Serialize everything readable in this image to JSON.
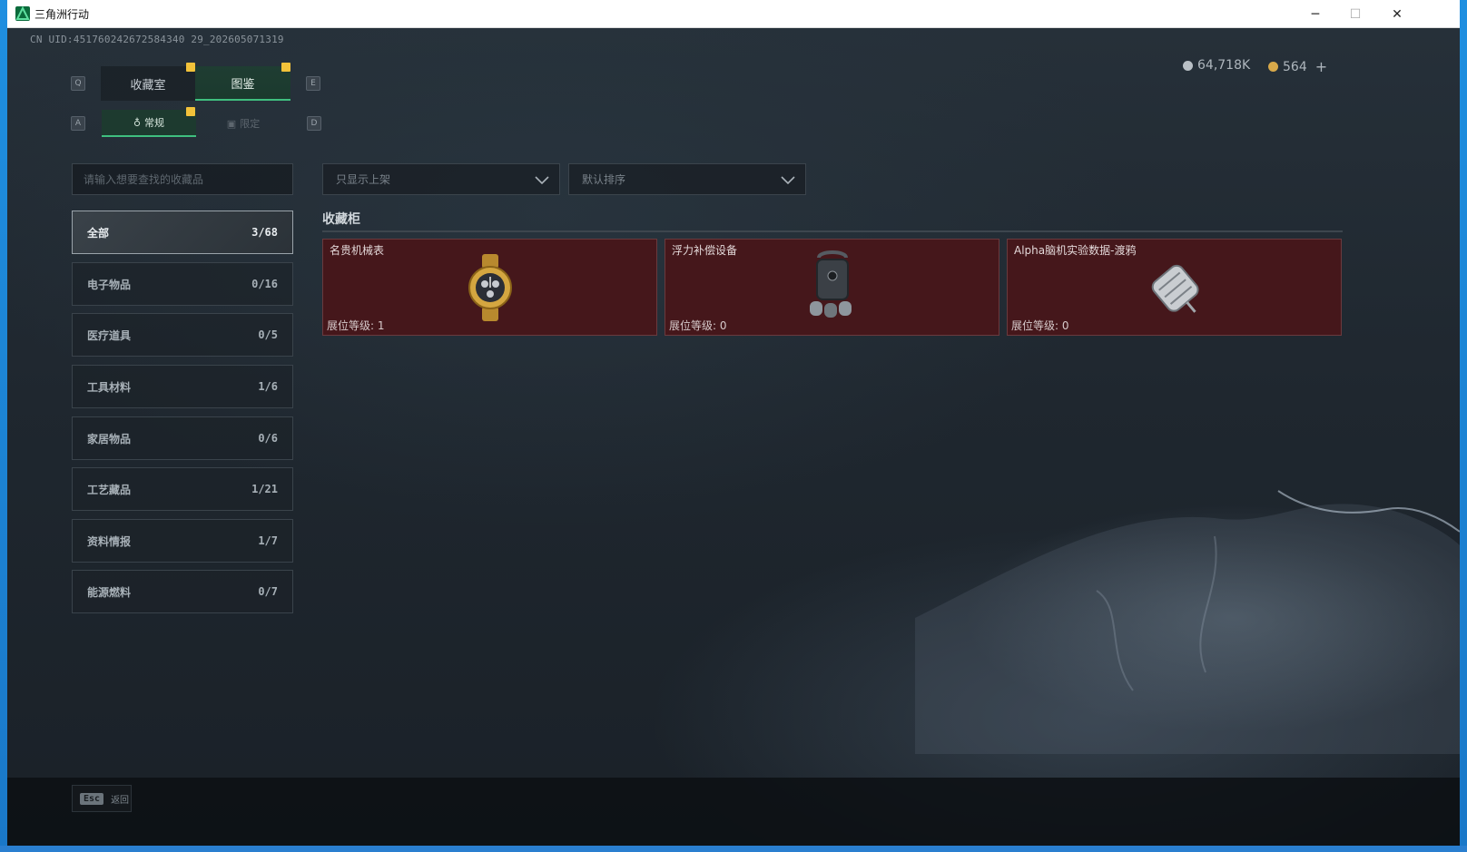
{
  "window": {
    "title": "三角洲行动",
    "minimize": "─",
    "maximize": "☐",
    "close": "✕"
  },
  "uid": "CN UID:451760242672584340 29_202605071319",
  "tabs": {
    "key_left": "Q",
    "key_right": "E",
    "items": [
      {
        "label": "收藏室",
        "active": false
      },
      {
        "label": "图鉴",
        "active": true
      }
    ]
  },
  "subtabs": {
    "key_left": "A",
    "key_right": "D",
    "items": [
      {
        "label": "常规",
        "active": true
      },
      {
        "label": "限定",
        "active": false
      }
    ]
  },
  "currency": {
    "silver": "64,718K",
    "gold": "564",
    "add": "+",
    "silver_color": "#b9c0c6",
    "gold_color": "#d8a94a"
  },
  "search": {
    "placeholder": "请输入想要查找的收藏品"
  },
  "filters": {
    "shelf": "只显示上架",
    "sort": "默认排序"
  },
  "categories": [
    {
      "label": "全部",
      "count": "3/68",
      "active": true
    },
    {
      "label": "电子物品",
      "count": "0/16",
      "active": false
    },
    {
      "label": "医疗道具",
      "count": "0/5",
      "active": false
    },
    {
      "label": "工具材料",
      "count": "1/6",
      "active": false
    },
    {
      "label": "家居物品",
      "count": "0/6",
      "active": false
    },
    {
      "label": "工艺藏品",
      "count": "1/21",
      "active": false
    },
    {
      "label": "资料情报",
      "count": "1/7",
      "active": false
    },
    {
      "label": "能源燃料",
      "count": "0/7",
      "active": false
    }
  ],
  "cabinet": {
    "title": "收藏柜",
    "items": [
      {
        "name": "名贵机械表",
        "level": "展位等级: 1",
        "icon": "watch-icon"
      },
      {
        "name": "浮力补偿设备",
        "level": "展位等级: 0",
        "icon": "buoyancy-device-icon"
      },
      {
        "name": "Alpha脑机实验数据-渡鸦",
        "level": "展位等级: 0",
        "icon": "data-capsule-icon"
      }
    ]
  },
  "footer": {
    "esc_key": "Esc",
    "esc_label": "返回"
  },
  "colors": {
    "accent_green": "#3fbf7f",
    "marker_yellow": "#f2c23a",
    "card_red": "#45171b"
  }
}
